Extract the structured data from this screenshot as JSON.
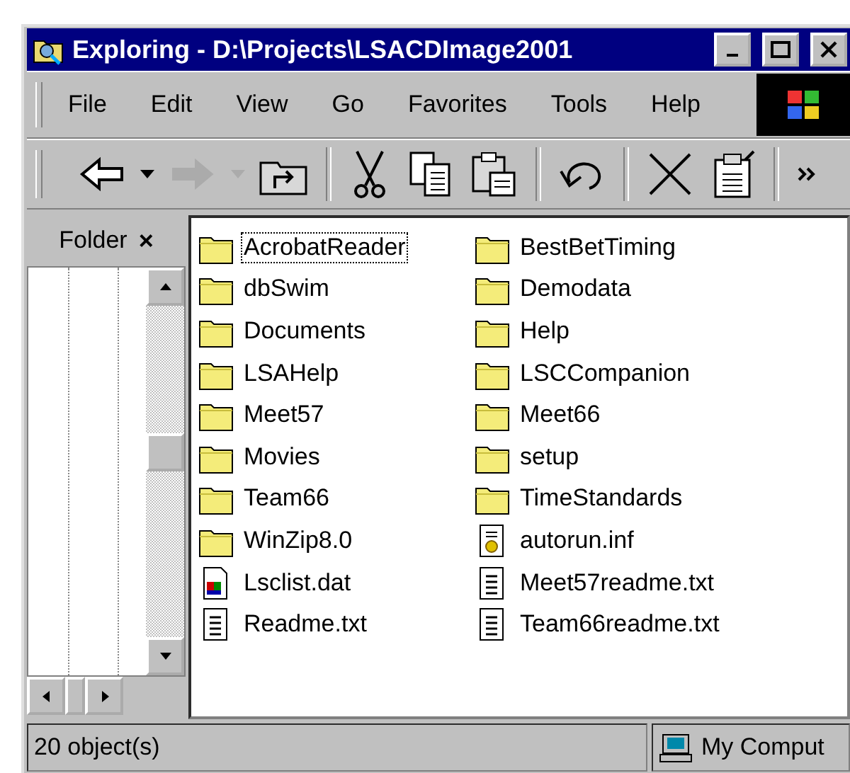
{
  "window": {
    "title": "Exploring - D:\\Projects\\LSACDImage2001"
  },
  "menu": [
    "File",
    "Edit",
    "View",
    "Go",
    "Favorites",
    "Tools",
    "Help"
  ],
  "toolbar": [
    {
      "kind": "back",
      "disabled": false
    },
    {
      "kind": "dropdown",
      "disabled": false
    },
    {
      "kind": "forward",
      "disabled": true
    },
    {
      "kind": "dropdown",
      "disabled": true
    },
    {
      "kind": "up",
      "disabled": false
    },
    {
      "kind": "separator"
    },
    {
      "kind": "cut",
      "disabled": false
    },
    {
      "kind": "copy",
      "disabled": false
    },
    {
      "kind": "paste",
      "disabled": false
    },
    {
      "kind": "separator"
    },
    {
      "kind": "undo",
      "disabled": false
    },
    {
      "kind": "separator"
    },
    {
      "kind": "delete",
      "disabled": false
    },
    {
      "kind": "properties",
      "disabled": false
    },
    {
      "kind": "separator"
    },
    {
      "kind": "more",
      "disabled": false
    }
  ],
  "folder_pane": {
    "title": "Folder",
    "close": "×"
  },
  "files": [
    {
      "name": "AcrobatReader",
      "kind": "folder",
      "selected": true
    },
    {
      "name": "dbSwim",
      "kind": "folder",
      "selected": false
    },
    {
      "name": "Documents",
      "kind": "folder",
      "selected": false
    },
    {
      "name": "LSAHelp",
      "kind": "folder",
      "selected": false
    },
    {
      "name": "Meet57",
      "kind": "folder",
      "selected": false
    },
    {
      "name": "Movies",
      "kind": "folder",
      "selected": false
    },
    {
      "name": "Team66",
      "kind": "folder",
      "selected": false
    },
    {
      "name": "WinZip8.0",
      "kind": "folder",
      "selected": false
    },
    {
      "name": "Lsclist.dat",
      "kind": "data",
      "selected": false
    },
    {
      "name": "Readme.txt",
      "kind": "text",
      "selected": false
    },
    {
      "name": "BestBetTiming",
      "kind": "folder",
      "selected": false
    },
    {
      "name": "Demodata",
      "kind": "folder",
      "selected": false
    },
    {
      "name": "Help",
      "kind": "folder",
      "selected": false
    },
    {
      "name": "LSCCompanion",
      "kind": "folder",
      "selected": false
    },
    {
      "name": "Meet66",
      "kind": "folder",
      "selected": false
    },
    {
      "name": "setup",
      "kind": "folder",
      "selected": false
    },
    {
      "name": "TimeStandards",
      "kind": "folder",
      "selected": false
    },
    {
      "name": "autorun.inf",
      "kind": "settings",
      "selected": false
    },
    {
      "name": "Meet57readme.txt",
      "kind": "text",
      "selected": false
    },
    {
      "name": "Team66readme.txt",
      "kind": "text",
      "selected": false
    }
  ],
  "status_bar": {
    "count": "20 object(s)",
    "location": "My Comput"
  }
}
